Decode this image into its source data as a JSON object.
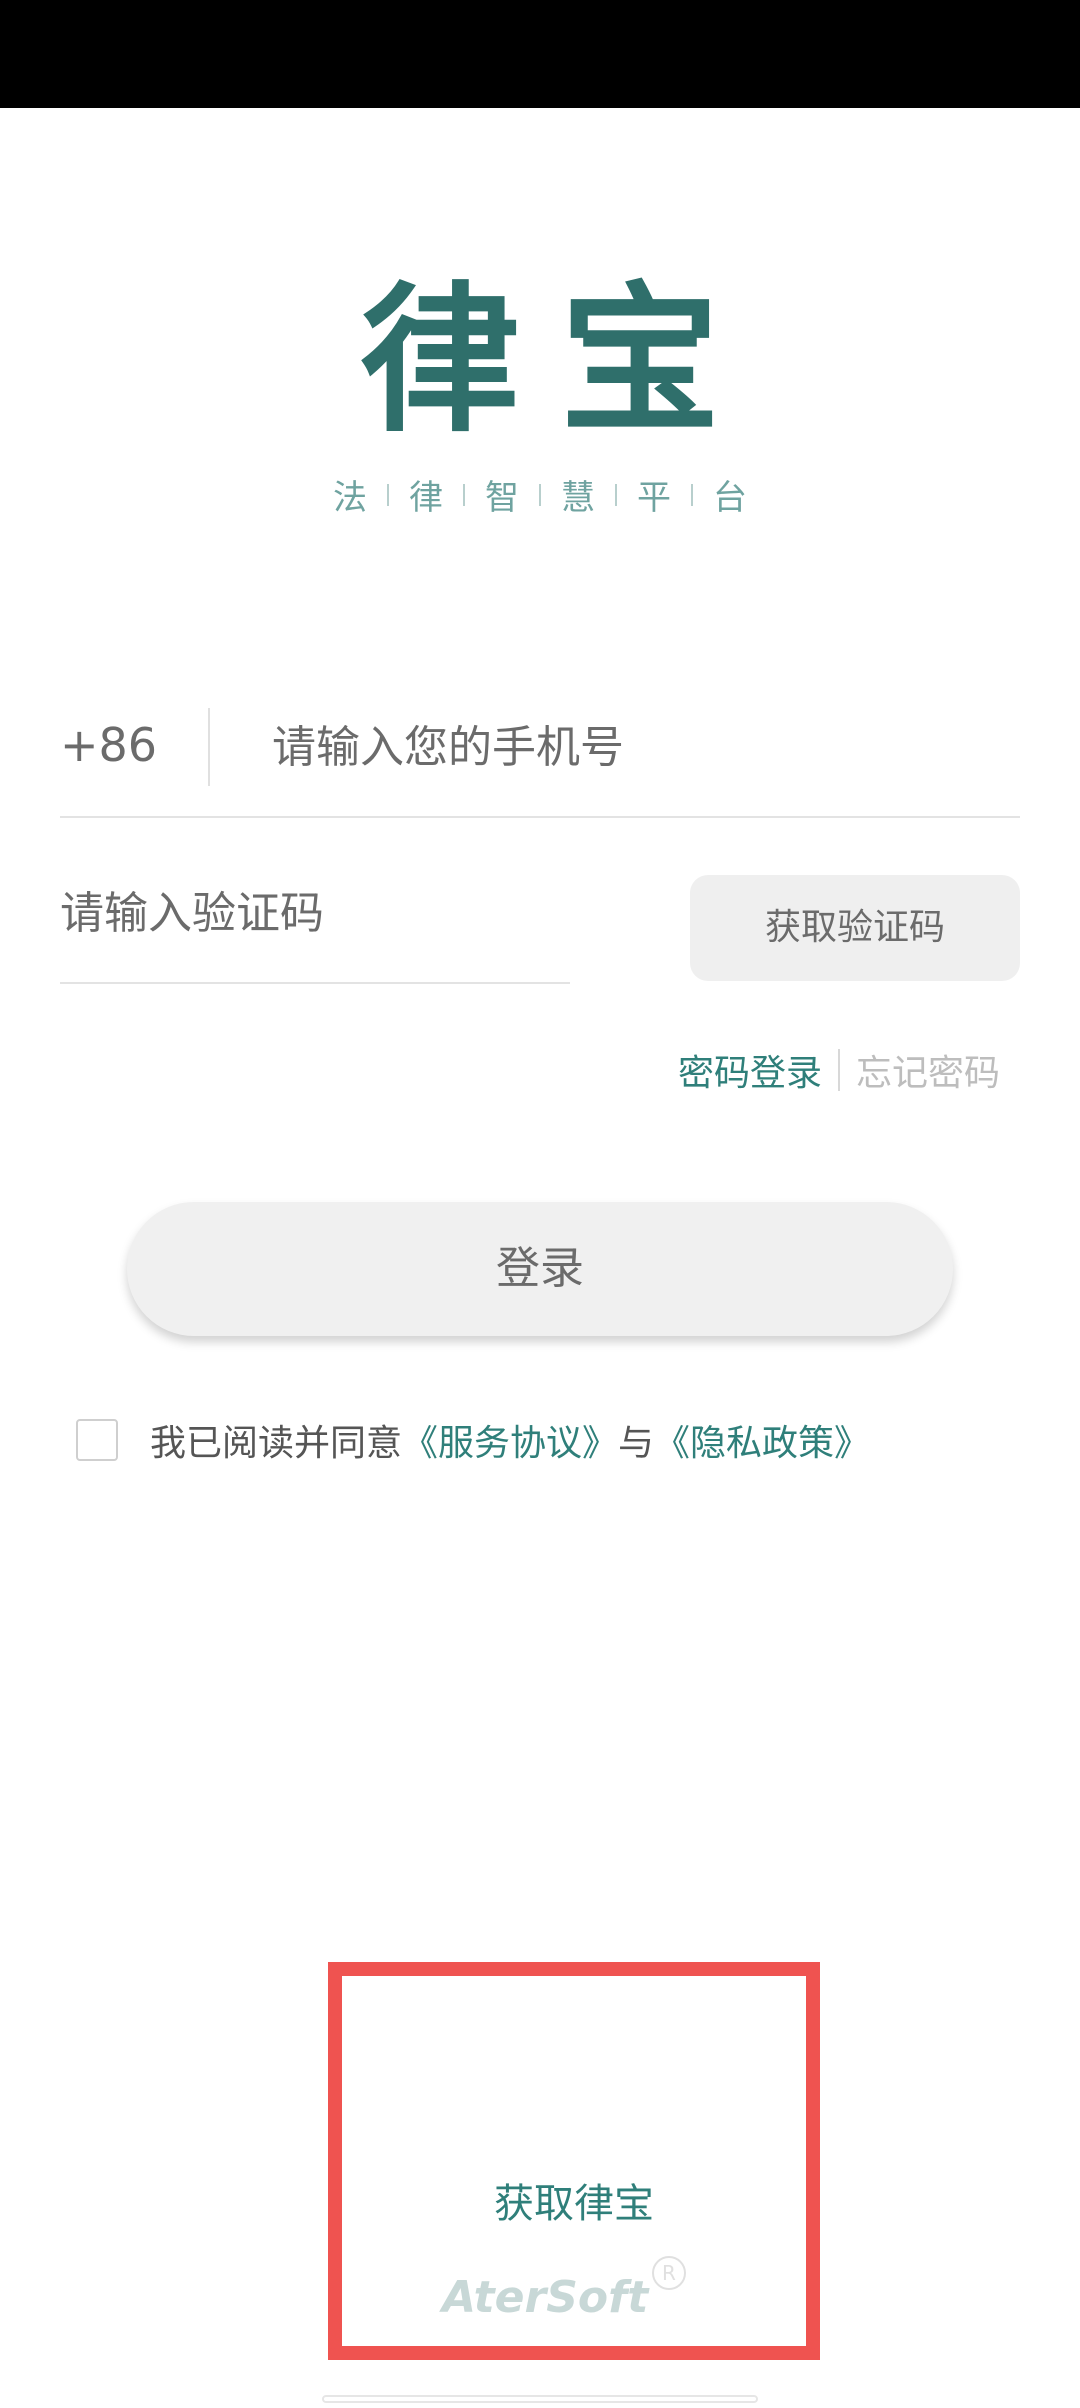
{
  "logo": {
    "title": "律宝",
    "tagline": [
      "法",
      "律",
      "智",
      "慧",
      "平",
      "台"
    ]
  },
  "login_form": {
    "country_code": "+86",
    "phone_placeholder": "请输入您的手机号",
    "code_placeholder": "请输入验证码",
    "get_code_label": "获取验证码",
    "password_login_label": "密码登录",
    "forgot_password_label": "忘记密码",
    "login_label": "登录"
  },
  "agreement": {
    "checked": false,
    "prefix": "我已阅读并同意",
    "terms_label": "《服务协议》",
    "conjunction": "与",
    "privacy_label": "《隐私政策》"
  },
  "promo": {
    "title": "获取律宝",
    "brand": "AterSoft",
    "registered_mark": "R"
  },
  "colors": {
    "brand_teal": "#2f6f6b",
    "link_teal": "#2f7f7a",
    "highlight_border": "#ef5350"
  }
}
